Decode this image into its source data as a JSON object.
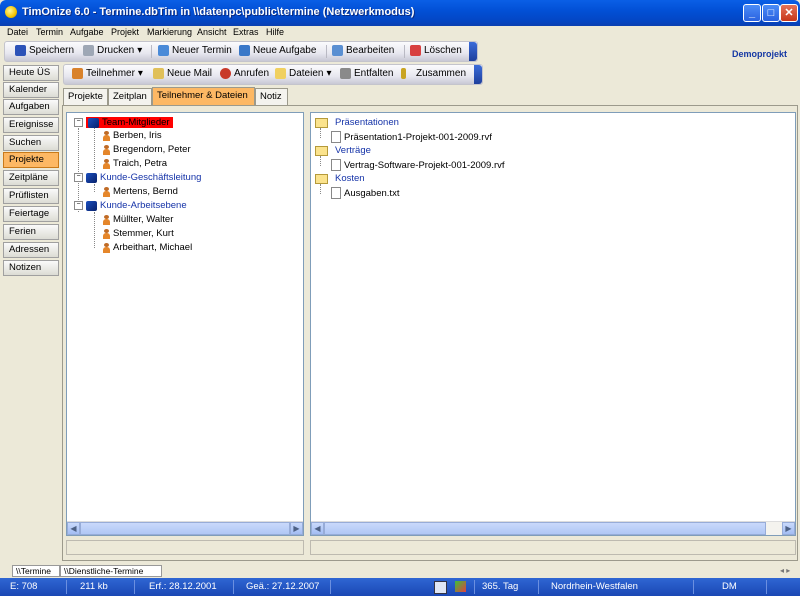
{
  "window": {
    "title": "TimOnize 6.0 - Termine.dbTim in \\\\datenpc\\public\\termine (Netzwerkmodus)",
    "minimize_glyph": "_",
    "maximize_glyph": "□",
    "close_glyph": "✕"
  },
  "menu": [
    "Datei",
    "Termin",
    "Aufgabe",
    "Projekt",
    "Markierung",
    "Ansicht",
    "Extras",
    "Hilfe"
  ],
  "toolbar": {
    "save": "Speichern",
    "print": "Drucken",
    "new_appointment": "Neuer Termin",
    "new_task": "Neue Aufgabe",
    "edit": "Bearbeiten",
    "delete": "Löschen",
    "dropdown_glyph": "▾"
  },
  "project_label": "Demoprojekt",
  "sidebar": {
    "items": [
      {
        "label": "Heute ÜS"
      },
      {
        "label": "Kalender"
      },
      {
        "label": "Aufgaben"
      },
      {
        "label": "Ereignisse"
      },
      {
        "label": "Suchen"
      },
      {
        "label": "Projekte",
        "active": true
      },
      {
        "label": "Zeitpläne"
      },
      {
        "label": "Prüflisten"
      },
      {
        "label": "Feiertage"
      },
      {
        "label": "Ferien"
      },
      {
        "label": "Adressen"
      },
      {
        "label": "Notizen"
      }
    ]
  },
  "toolbar2": {
    "participants": "Teilnehmer",
    "new_mail": "Neue Mail",
    "call": "Anrufen",
    "files": "Dateien",
    "expand": "Entfalten",
    "collapse": "Zusammen"
  },
  "tabs": [
    {
      "label": "Projekte"
    },
    {
      "label": "Zeitplan"
    },
    {
      "label": "Teilnehmer & Dateien",
      "active": true
    },
    {
      "label": "Notiz"
    }
  ],
  "participants_tree": {
    "groups": [
      {
        "label": "Team-Mitglieder",
        "selected": true,
        "members": [
          "Berben, Iris",
          "Bregendorn, Peter",
          "Traich, Petra"
        ]
      },
      {
        "label": "Kunde-Geschäftsleitung",
        "members": [
          "Mertens, Bernd"
        ]
      },
      {
        "label": "Kunde-Arbeitsebene",
        "members": [
          "Müllter, Walter",
          "Stemmer, Kurt",
          "Arbeithart, Michael"
        ]
      }
    ]
  },
  "files_tree": {
    "folders": [
      {
        "label": "Präsentationen",
        "files": [
          "Präsentation1-Projekt-001-2009.rvf"
        ]
      },
      {
        "label": "Verträge",
        "files": [
          "Vertrag-Software-Projekt-001-2009.rvf"
        ]
      },
      {
        "label": "Kosten",
        "files": [
          "Ausgaben.txt"
        ]
      }
    ]
  },
  "bottom_tabs": [
    "\\\\Termine",
    "\\\\Dienstliche-Termine"
  ],
  "statusbar": {
    "entries": "E: 708",
    "size": "211 kb",
    "created": "Erf.: 28.12.2001",
    "changed": "Geä.: 27.12.2007",
    "day": "365. Tag",
    "region": "Nordrhein-Westfalen",
    "currency": "DM"
  },
  "colors": {
    "accent_orange": "#fdb864",
    "title_blue": "#0250d6",
    "selected_red": "#ff0000",
    "link_blue": "#1533a8"
  }
}
